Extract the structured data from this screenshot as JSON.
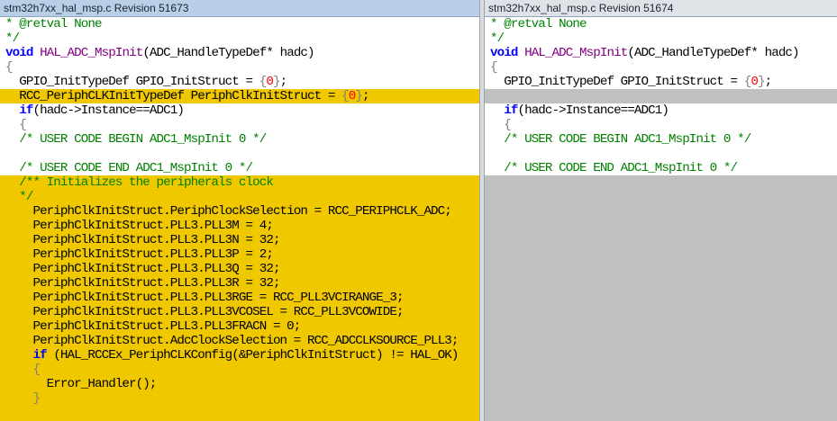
{
  "left_pane": {
    "title": "stm32h7xx_hal_msp.c Revision 51673",
    "lines": [
      {
        "text": "* @retval None",
        "kind": "comment",
        "state": "normal"
      },
      {
        "text": "*/",
        "kind": "comment",
        "state": "normal"
      },
      {
        "text": "void HAL_ADC_MspInit(ADC_HandleTypeDef* hadc)",
        "kind": "signature",
        "state": "normal"
      },
      {
        "text": "{",
        "kind": "punct",
        "state": "normal"
      },
      {
        "text": "  GPIO_InitTypeDef GPIO_InitStruct = {0};",
        "kind": "init",
        "state": "normal"
      },
      {
        "text": "  RCC_PeriphCLKInitTypeDef PeriphClkInitStruct = {0};",
        "kind": "init",
        "state": "changed"
      },
      {
        "text": "  if(hadc->Instance==ADC1)",
        "kind": "if",
        "state": "normal"
      },
      {
        "text": "  {",
        "kind": "punct",
        "state": "normal"
      },
      {
        "text": "  /* USER CODE BEGIN ADC1_MspInit 0 */",
        "kind": "comment",
        "state": "normal"
      },
      {
        "text": "",
        "kind": "plain",
        "state": "normal"
      },
      {
        "text": "  /* USER CODE END ADC1_MspInit 0 */",
        "kind": "comment",
        "state": "normal"
      },
      {
        "text": "  /** Initializes the peripherals clock",
        "kind": "comment",
        "state": "changed"
      },
      {
        "text": "  */",
        "kind": "comment",
        "state": "changed"
      },
      {
        "text": "    PeriphClkInitStruct.PeriphClockSelection = RCC_PERIPHCLK_ADC;",
        "kind": "plain",
        "state": "changed"
      },
      {
        "text": "    PeriphClkInitStruct.PLL3.PLL3M = 4;",
        "kind": "plain",
        "state": "changed"
      },
      {
        "text": "    PeriphClkInitStruct.PLL3.PLL3N = 32;",
        "kind": "plain",
        "state": "changed"
      },
      {
        "text": "    PeriphClkInitStruct.PLL3.PLL3P = 2;",
        "kind": "plain",
        "state": "changed"
      },
      {
        "text": "    PeriphClkInitStruct.PLL3.PLL3Q = 32;",
        "kind": "plain",
        "state": "changed"
      },
      {
        "text": "    PeriphClkInitStruct.PLL3.PLL3R = 32;",
        "kind": "plain",
        "state": "changed"
      },
      {
        "text": "    PeriphClkInitStruct.PLL3.PLL3RGE = RCC_PLL3VCIRANGE_3;",
        "kind": "plain",
        "state": "changed"
      },
      {
        "text": "    PeriphClkInitStruct.PLL3.PLL3VCOSEL = RCC_PLL3VCOWIDE;",
        "kind": "plain",
        "state": "changed"
      },
      {
        "text": "    PeriphClkInitStruct.PLL3.PLL3FRACN = 0;",
        "kind": "plain",
        "state": "changed"
      },
      {
        "text": "    PeriphClkInitStruct.AdcClockSelection = RCC_ADCCLKSOURCE_PLL3;",
        "kind": "plain",
        "state": "changed"
      },
      {
        "text": "    if (HAL_RCCEx_PeriphCLKConfig(&PeriphClkInitStruct) != HAL_OK)",
        "kind": "if",
        "state": "changed"
      },
      {
        "text": "    {",
        "kind": "punct",
        "state": "changed"
      },
      {
        "text": "      Error_Handler();",
        "kind": "plain",
        "state": "changed"
      },
      {
        "text": "    }",
        "kind": "punct",
        "state": "changed"
      }
    ]
  },
  "right_pane": {
    "title": "stm32h7xx_hal_msp.c Revision 51674",
    "lines": [
      {
        "text": "* @retval None",
        "kind": "comment",
        "state": "normal"
      },
      {
        "text": "*/",
        "kind": "comment",
        "state": "normal"
      },
      {
        "text": "void HAL_ADC_MspInit(ADC_HandleTypeDef* hadc)",
        "kind": "signature",
        "state": "normal"
      },
      {
        "text": "{",
        "kind": "punct",
        "state": "normal"
      },
      {
        "text": "  GPIO_InitTypeDef GPIO_InitStruct = {0};",
        "kind": "init",
        "state": "normal"
      },
      {
        "text": "",
        "kind": "plain",
        "state": "missing"
      },
      {
        "text": "  if(hadc->Instance==ADC1)",
        "kind": "if",
        "state": "normal"
      },
      {
        "text": "  {",
        "kind": "punct",
        "state": "normal"
      },
      {
        "text": "  /* USER CODE BEGIN ADC1_MspInit 0 */",
        "kind": "comment",
        "state": "normal"
      },
      {
        "text": "",
        "kind": "plain",
        "state": "normal"
      },
      {
        "text": "  /* USER CODE END ADC1_MspInit 0 */",
        "kind": "comment",
        "state": "normal"
      },
      {
        "text": "",
        "kind": "plain",
        "state": "missing"
      },
      {
        "text": "",
        "kind": "plain",
        "state": "missing"
      },
      {
        "text": "",
        "kind": "plain",
        "state": "missing"
      },
      {
        "text": "",
        "kind": "plain",
        "state": "missing"
      },
      {
        "text": "",
        "kind": "plain",
        "state": "missing"
      },
      {
        "text": "",
        "kind": "plain",
        "state": "missing"
      },
      {
        "text": "",
        "kind": "plain",
        "state": "missing"
      },
      {
        "text": "",
        "kind": "plain",
        "state": "missing"
      },
      {
        "text": "",
        "kind": "plain",
        "state": "missing"
      },
      {
        "text": "",
        "kind": "plain",
        "state": "missing"
      },
      {
        "text": "",
        "kind": "plain",
        "state": "missing"
      },
      {
        "text": "",
        "kind": "plain",
        "state": "missing"
      },
      {
        "text": "",
        "kind": "plain",
        "state": "missing"
      },
      {
        "text": "",
        "kind": "plain",
        "state": "missing"
      },
      {
        "text": "",
        "kind": "plain",
        "state": "missing"
      },
      {
        "text": "",
        "kind": "plain",
        "state": "missing"
      }
    ]
  },
  "colors": {
    "changed_highlight": "#f0c800",
    "missing_block": "#c0c0c0",
    "comment": "#008000",
    "keyword": "#0000ff",
    "function": "#800080",
    "number": "#ff0000"
  }
}
